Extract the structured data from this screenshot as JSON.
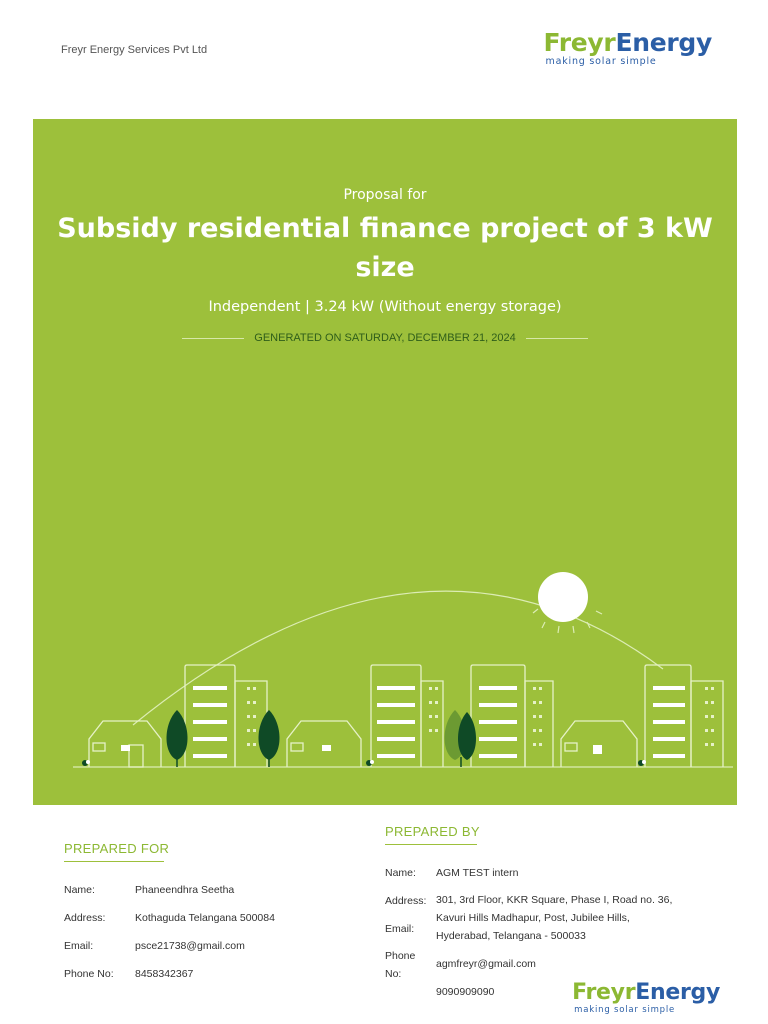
{
  "header": {
    "company_name": "Freyr Energy Services Pvt Ltd",
    "logo_word_1": "Freyr",
    "logo_word_2": "Energy",
    "logo_tagline": "making solar simple"
  },
  "hero": {
    "pre_title": "Proposal for",
    "title": "Subsidy residential finance project of 3 kW size",
    "subtitle": "Independent | 3.24 kW (Without energy storage)",
    "generated": "GENERATED ON SATURDAY, DECEMBER 21, 2024"
  },
  "prepared_for": {
    "heading": "PREPARED FOR",
    "name_label": "Name:",
    "name": "Phaneendhra Seetha",
    "address_label": "Address:",
    "address": "Kothaguda Telangana 500084",
    "email_label": "Email:",
    "email": "psce21738@gmail.com",
    "phone_label": "Phone No:",
    "phone": "8458342367"
  },
  "prepared_by": {
    "heading": "PREPARED BY",
    "name_label": "Name:",
    "name": "AGM TEST intern",
    "address_label": "Address:",
    "address_line_1": "301, 3rd Floor, KKR Square, Phase I, Road no. 36,",
    "address_line_2": "Kavuri Hills Madhapur, Post, Jubilee Hills,",
    "address_line_3": "Hyderabad, Telangana - 500033",
    "email_label": "Email:",
    "email": "agmfreyr@gmail.com",
    "phone_label_1": "Phone",
    "phone_label_2": "No:",
    "phone": "9090909090"
  },
  "colors": {
    "brand_green": "#9dc03b",
    "brand_blue": "#2b5ea6",
    "dark_green": "#2f5e1a"
  }
}
